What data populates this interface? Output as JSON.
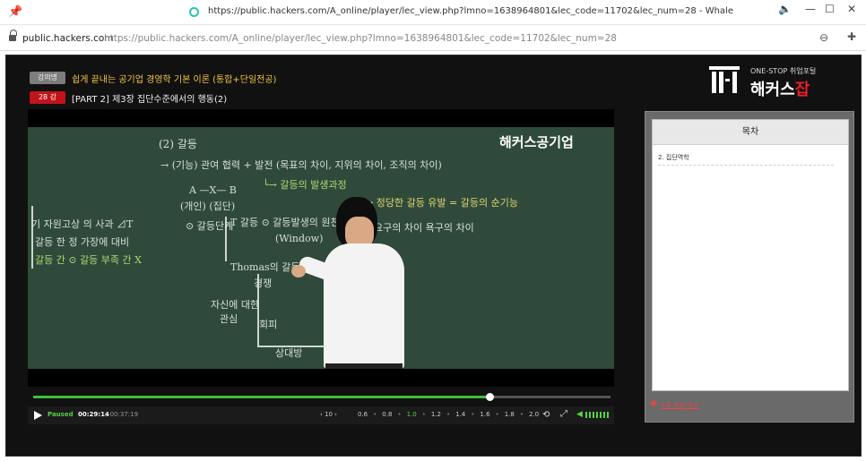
{
  "browser": {
    "window_title": "https://public.hackers.com/A_online/player/lec_view.php?lmno=1638964801&lec_code=11702&lec_num=28 - Whale",
    "host": "public.hackers.com",
    "url": "https://public.hackers.com/A_online/player/lec_view.php?lmno=1638964801&lec_code=11702&lec_num=28",
    "icons": [
      "pin-icon",
      "loading-icon",
      "speaker-icon",
      "minimize-icon",
      "maximize-icon",
      "close-icon",
      "lock-icon",
      "zoom-icon",
      "extension-icon"
    ]
  },
  "header": {
    "lecture_label": "강의명",
    "lecture_title": "쉽게 끝내는 공기업 경영학 기본 이론 (통합+단일전공)",
    "episode_label": "28 강",
    "episode_title": "[PART 2] 제3장 집단수준에서의 행동(2)"
  },
  "brand": {
    "tagline": "ONE-STOP 취업포털",
    "name_main": "해커스",
    "name_accent": "잡",
    "accent_color": "#e5202a"
  },
  "video": {
    "watermark": "해커스공기업",
    "status": "Paused",
    "current_time": "00:29:14",
    "total_time": "/ 00:37:19",
    "progress_fraction": 0.79,
    "skip_label": "‹ 10 ›",
    "speeds": [
      "0.6",
      "0.8",
      "1.0",
      "1.2",
      "1.4",
      "1.6",
      "1.8",
      "2.0"
    ],
    "selected_speed": "1.0"
  },
  "toc": {
    "heading": "목차",
    "items": [
      "2. 집단역학"
    ],
    "footer_link": "오류 제보/개선"
  }
}
